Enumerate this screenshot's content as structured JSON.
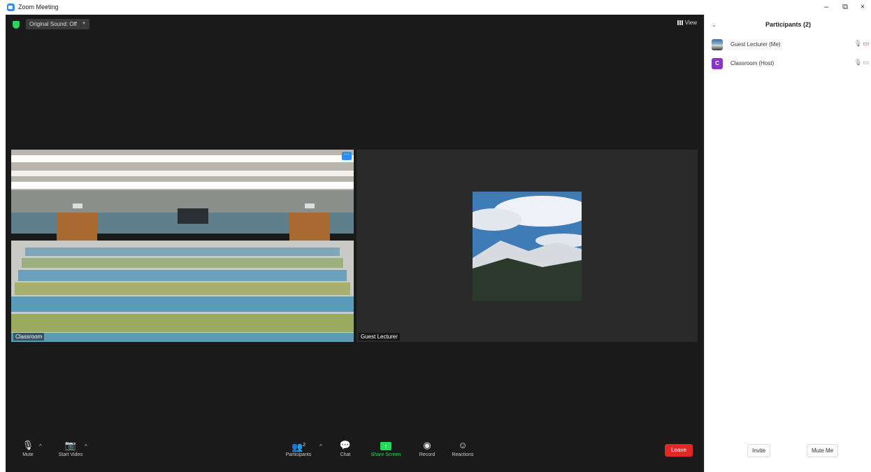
{
  "window": {
    "title": "Zoom Meeting",
    "minimize": "–",
    "restore": "⧉",
    "close": "×"
  },
  "topbar": {
    "original_sound_label": "Original Sound: Off",
    "view_label": "View"
  },
  "tiles": [
    {
      "name": "Classroom",
      "more": "···"
    },
    {
      "name": "Guest Lecturer"
    }
  ],
  "controls": {
    "mute": "Mute",
    "start_video": "Start Video",
    "participants": "Participants",
    "participants_count": "2",
    "chat": "Chat",
    "share_screen": "Share Screen",
    "record": "Record",
    "reactions": "Reactions",
    "leave": "Leave"
  },
  "participants_panel": {
    "title": "Participants (2)",
    "list": [
      {
        "name": "Guest Lecturer (Me)",
        "avatar": "photo",
        "mic": "mic-icon",
        "camera": "video-off-icon"
      },
      {
        "name": "Classroom (Host)",
        "avatar_letter": "C",
        "mic": "mic-icon",
        "camera": "video-icon"
      }
    ],
    "invite_label": "Invite",
    "mute_me_label": "Mute Me"
  },
  "colors": {
    "accent": "#2d8cff",
    "leave": "#e02828",
    "share": "#23d959",
    "avatar_purple": "#8a35c8",
    "stage": "#1a1a1a"
  }
}
